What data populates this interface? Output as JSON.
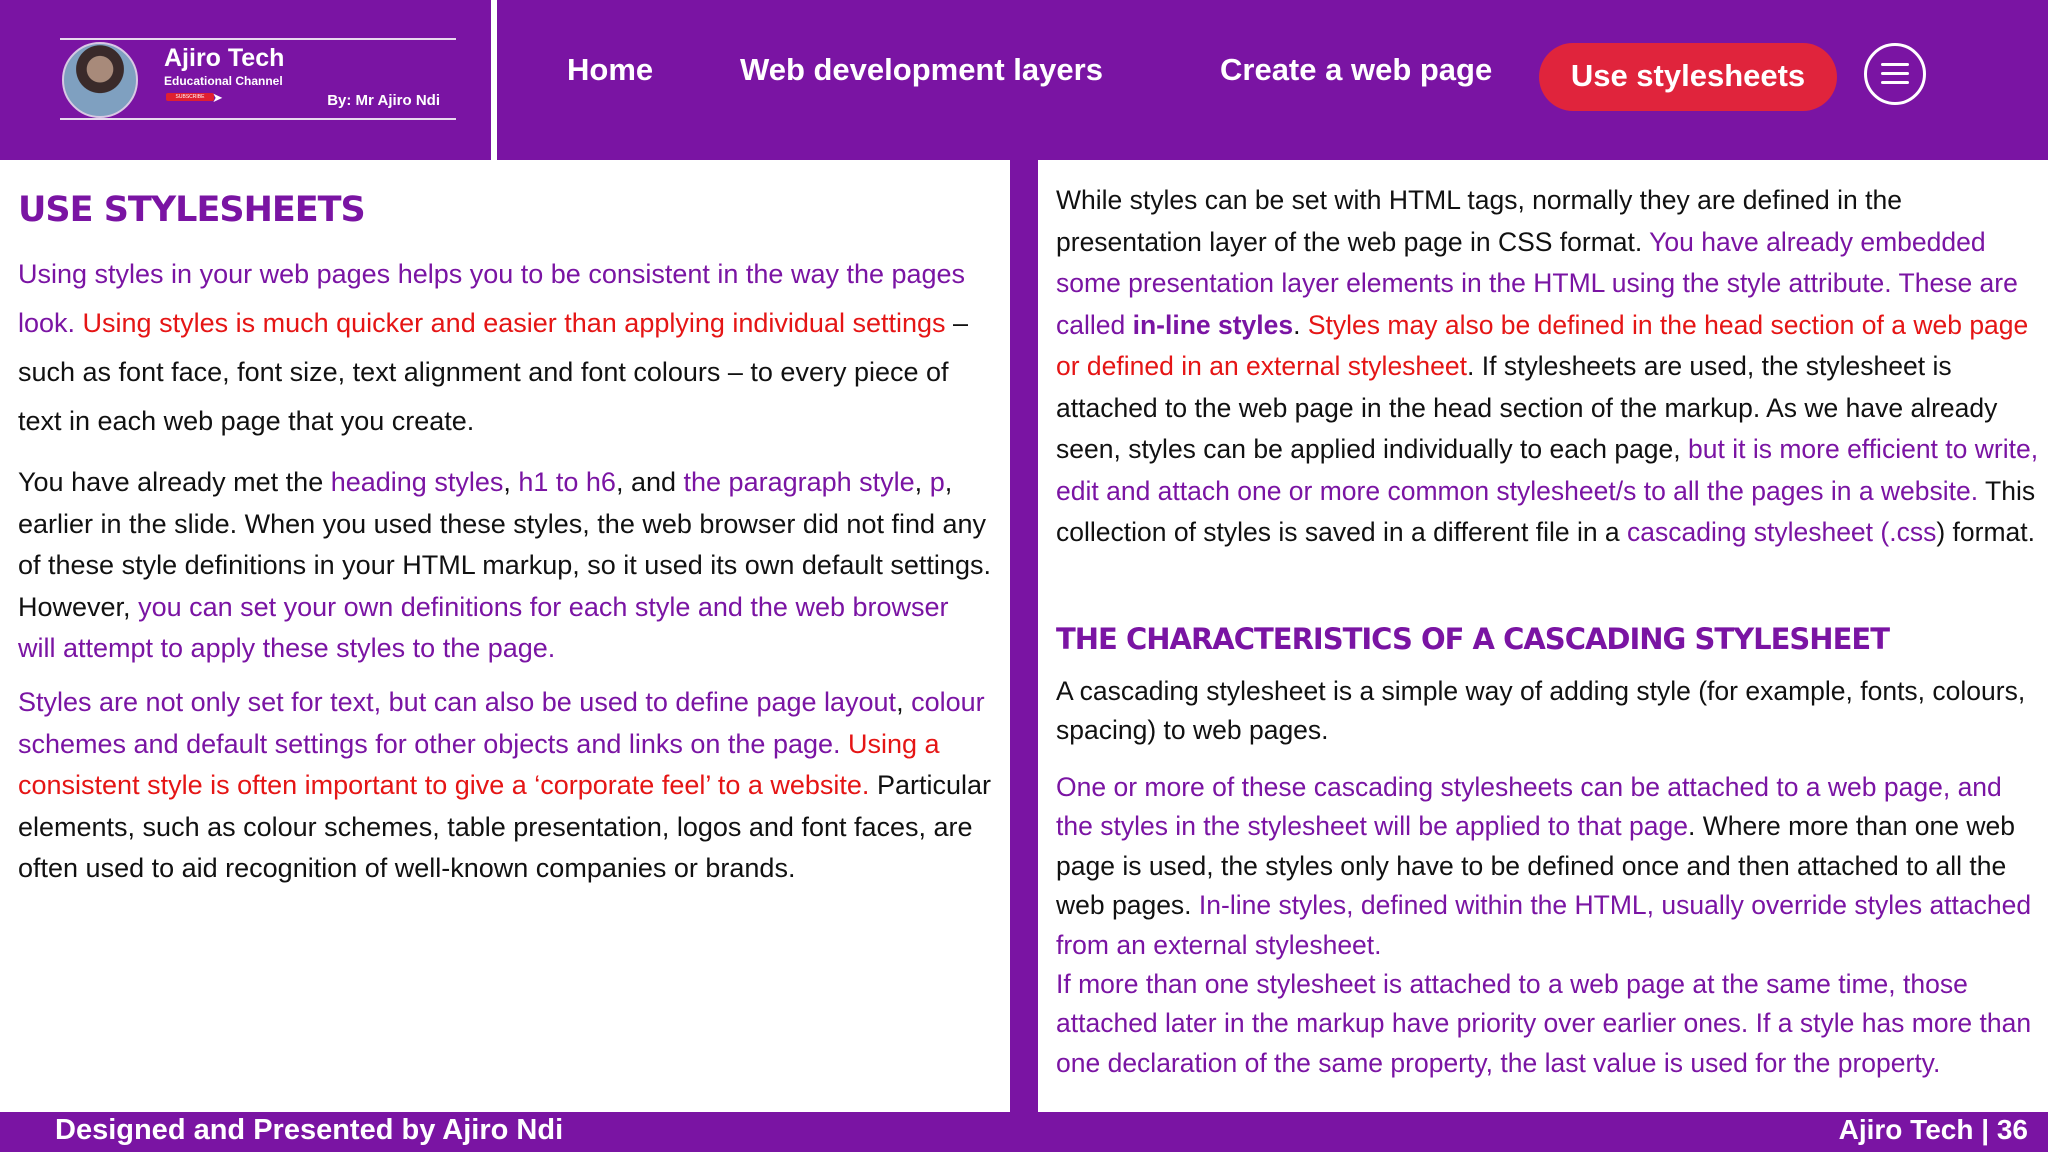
{
  "header": {
    "brand": {
      "title": "Ajiro Tech",
      "subtitle": "Educational Channel",
      "subscribe": "SUBSCRIBE",
      "byline": "By: Mr Ajiro Ndi"
    },
    "nav": {
      "home": "Home",
      "layers": "Web development layers",
      "create": "Create a web page",
      "active": "Use stylesheets"
    }
  },
  "left": {
    "heading": "USE STYLESHEETS",
    "p1": [
      "Using styles in your web pages helps you to be consistent in the way the pages look.",
      " Using styles is much quicker and easier than applying individual settings",
      " – such as font face, font size, text alignment and font colours – to every piece of text in each web page that you create."
    ],
    "p2": [
      "You have already met the ",
      "heading styles",
      ", ",
      "h1 to h6",
      ", and ",
      "the paragraph style",
      ", ",
      "p",
      ", earlier in the slide. When you used these styles, the web browser did not find any of these style definitions in your HTML markup, so it used its own default settings. However, ",
      "you can set your own definitions for each style and the web browser will attempt to apply these styles to the page."
    ],
    "p3": [
      "Styles are not only set for text, but can also be used to define page layout",
      ", ",
      "colour schemes and default settings for other objects and links on the page.",
      " Using a consistent style is often important to give a ‘corporate feel’ to a website.",
      " Particular elements, such as colour schemes, table presentation, logos and font faces, are often used to aid recognition of well-known companies or brands."
    ]
  },
  "right": {
    "p1": [
      "While styles can be set with HTML tags, normally they are defined in the presentation layer of the web page in CSS format. ",
      "You have already embedded some presentation layer elements in the HTML using the style attribute. These are called ",
      "in-line styles",
      ". ",
      "Styles may also be defined in the head section of a web page or defined in an external stylesheet",
      ". If stylesheets are used, the stylesheet is attached to the web page in the head section of the markup. As we have already seen, styles can be applied individually to each page, ",
      "but it is more efficient to write, edit and attach one or more common stylesheet/s to all the pages in a website.",
      " This collection of styles is saved in a different file in a ",
      "cascading stylesheet (.css",
      ") format."
    ],
    "heading": "THE CHARACTERISTICS OF A CASCADING STYLESHEET",
    "p2": "A cascading stylesheet is a simple way of adding style (for example, fonts, colours, spacing) to web pages.",
    "p3": [
      "One or more of these cascading stylesheets can be attached to a web page",
      ", and the styles in the stylesheet will be applied to that page",
      ". Where more than one web page is used, the styles only have to be defined once and then attached to all the web pages. ",
      "In-line styles, defined within the HTML, usually override styles attached from an external stylesheet."
    ],
    "p4": "If more than one stylesheet is attached to a web page at the same time, those attached later in the markup have priority over earlier ones. If a style has more than one declaration of the same property, the last value is used for the property."
  },
  "footer": {
    "left": "Designed and Presented by Ajiro Ndi",
    "right": "Ajiro Tech | 36"
  },
  "colors": {
    "brand_purple": "#7a14a3",
    "accent_red": "#e0243c",
    "text_red": "#e51515"
  }
}
